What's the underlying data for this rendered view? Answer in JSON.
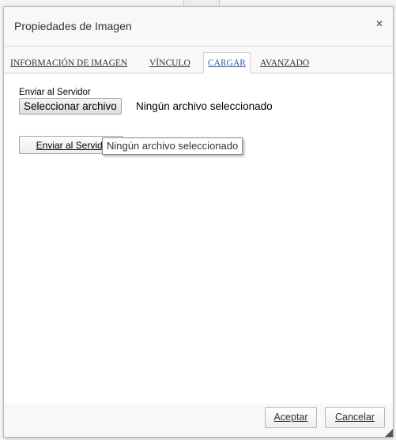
{
  "dialog": {
    "title": "Propiedades de Imagen",
    "close_symbol": "×"
  },
  "tabs": [
    {
      "label": "INFORMACIÓN DE IMAGEN",
      "active": false
    },
    {
      "label": "VÍNCULO",
      "active": false
    },
    {
      "label": "CARGAR",
      "active": true
    },
    {
      "label": "AVANZADO",
      "active": false
    }
  ],
  "upload": {
    "section_label": "Enviar al Servidor",
    "choose_file_label": "Seleccionar archivo",
    "file_status": "Ningún archivo seleccionado",
    "send_button_label": "Enviar al Servidor",
    "tooltip_text": "Ningún archivo seleccionado"
  },
  "footer": {
    "ok_label": "Aceptar",
    "cancel_label": "Cancelar"
  },
  "colors": {
    "active_tab_text": "#2b5b9c",
    "dialog_border": "#b2b2b2"
  },
  "icons": {
    "close": "close-icon",
    "resize": "resize-grip-icon"
  }
}
